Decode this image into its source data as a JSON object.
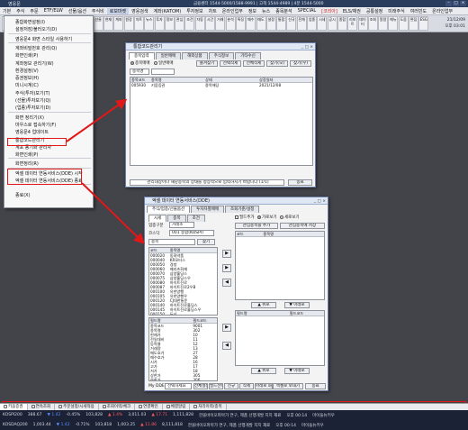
{
  "app": {
    "title": "영웅문",
    "server_info": "금융센터 1544-5000/1588-9991 | 고객 1544-4989 | 4분 1544-5000"
  },
  "menu": [
    "기본",
    "주식",
    "주문",
    "ETF/ELW",
    "선물/옵션",
    "주식비",
    "로보마켓",
    "영웅검색",
    "계좌(KATOM)",
    "투자정보",
    "차트",
    "온라인업무",
    "정보",
    "뉴스",
    "종목분석",
    "SPECIAL",
    "[코리아]",
    "ELS/채권",
    "공통설정",
    "미래주식",
    "여러빈도",
    "온라인업무"
  ],
  "toolbar": {
    "items": [
      "체결",
      "신고",
      "영웅",
      "알림",
      "종목",
      "주문",
      "매매",
      "잔고",
      "주식",
      "선물",
      "현재",
      "계좌",
      "원장",
      "차트",
      "뉴스",
      "투자",
      "정보",
      "관심",
      "조건",
      "자동",
      "시간",
      "거래",
      "분석",
      "특징",
      "매수",
      "매도",
      "설정",
      "통합",
      "신규",
      "전체",
      "업종",
      "시세",
      "공시",
      "종합",
      "리포트",
      "데이터",
      "조회",
      "알람",
      "메뉴",
      "도움",
      "편집",
      "ESG"
    ],
    "clock_date": "21/12/09",
    "clock_time": "오후 03:01"
  },
  "dropdown": {
    "items": [
      "종합화면설정(I)",
      "설정저장/불러오기(D)",
      "영웅문4 화면 스타일 사용하기",
      "계좌비밀번호 관리(Q)",
      "화면인쇄(P)",
      "계좌정보 관리기(W)",
      "환경설정(V)",
      "증권정보(H)",
      "미니시계(C)",
      "주식(투자)보기(T)",
      "(선물)투자보기(Q)",
      "(업종)투자보기(D)",
      "화면 정리기(X)",
      "마우스로 접속하기(F)",
      "영웅문4 업데이트",
      "통합코드관리기",
      "계포 동기화 관리자",
      "화면인쇄(P)",
      "화면정리(R)",
      "엑셀 데이터 연동서비스(DDE) 시작",
      "엑셀 데이터 연동서비스(DDE) 종료",
      "종료(X)"
    ]
  },
  "code_mgr": {
    "title": "통합코드관리기",
    "tabs": [
      "종목입력",
      "일반매매",
      "해외상품",
      "주식정보",
      "기타수신"
    ],
    "radio_a": "종목매매",
    "radio_b": "일반매매",
    "buttons": [
      "즐겨찾기",
      "선택삭제",
      "전체삭제",
      "찾기(모)",
      "찾기(우)"
    ],
    "filter": "종목명",
    "cols": [
      "종목코드",
      "종목명",
      "상태",
      "상장일자"
    ],
    "rows": [
      [
        "005930",
        "키움증권",
        "종목해당",
        "2021/12/08"
      ]
    ],
    "hint": "관리대상이나 해당종목의 상태를 정상적으로 입력하시기 바랍니다 (1/1)",
    "close": "종료"
  },
  "dde": {
    "title": "엑셀 데이터 연동서비스(DDE)",
    "main_tabs": [
      "주식/업종/선물옵션",
      "투자자별매매",
      "조회기준/설정"
    ],
    "sub_tabs": [
      "시세",
      "종목",
      "조건"
    ],
    "market": "거래소",
    "market2": "코스닥",
    "kospi_label": "업종구분",
    "kospi_val": "001 종합(KOSPI)",
    "code_input": "종목",
    "btn_search": "찾기",
    "list_cols": [
      "코드",
      "종목명"
    ],
    "codes": [
      [
        "000020",
        "동화약품"
      ],
      [
        "000040",
        "KR모터스"
      ],
      [
        "000050",
        "경방"
      ],
      [
        "000060",
        "메리츠화재"
      ],
      [
        "000070",
        "삼양홀딩스"
      ],
      [
        "000075",
        "삼양홀딩스우"
      ],
      [
        "000080",
        "하이트진로"
      ],
      [
        "000087",
        "하이트진로2우B"
      ],
      [
        "000100",
        "유한양행"
      ],
      [
        "000105",
        "유한양행우"
      ],
      [
        "000120",
        "CJ대한통운"
      ],
      [
        "000140",
        "하이트진로홀딩스"
      ],
      [
        "000145",
        "하이트진로홀딩스우"
      ],
      [
        "000150",
        "두산"
      ]
    ],
    "field_cols": [
      "필드명",
      "필드코드"
    ],
    "fields": [
      [
        "종목코드",
        "9001"
      ],
      [
        "종목명",
        "302"
      ],
      [
        "현재가",
        "10"
      ],
      [
        "전일대비",
        "11"
      ],
      [
        "등락율",
        "12"
      ],
      [
        "거래량",
        "13"
      ],
      [
        "매도호가",
        "27"
      ],
      [
        "매수호가",
        "28"
      ],
      [
        "시가",
        "16"
      ],
      [
        "고가",
        "17"
      ],
      [
        "저가",
        "18"
      ],
      [
        "상한가",
        "305"
      ],
      [
        "하한가",
        "306"
      ],
      [
        "전일종가",
        "307"
      ]
    ],
    "right_opts": [
      "필드추가",
      "가로보기",
      "세로보기"
    ],
    "right_btns": [
      "관심종목을 추가",
      "관심종목에 저장"
    ],
    "right_cols": [
      "코드",
      "종목명"
    ],
    "right_cols2": [
      "필드명",
      "필드코드"
    ],
    "up": "▲ 위로",
    "down": "▼ 아래로",
    "bottom": [
      "전체설정",
      "필드선택",
      "신규",
      "삭제",
      "아래로 화면 출력"
    ],
    "my_dde": "My DDE",
    "my_dde_val": "선택하세요",
    "send": "엑셀로 보내기",
    "close": "종료"
  },
  "status": {
    "tabs": [
      "키움증권",
      "연속조회",
      "주문설정/시세적용",
      "조회이력/체크",
      "연결확인",
      "체결알림",
      "처리이력/종목"
    ],
    "ticker1": [
      [
        "KOSPI200",
        "388.67",
        "▼ 1.42",
        "-0.45%",
        "103,828",
        "▲ 1.4%",
        "3,011.03",
        "▲ 17.71",
        "1,111,828",
        "한올바이오파마가 연구, 제품 선행개발 지지 재료",
        "오후 00:14",
        "마이들뉴키우"
      ]
    ],
    "ticker2": [
      [
        "KOSDAQ200",
        "1,003.44",
        "▼ 1.42",
        "-0.71%",
        "103,818",
        "1,003.25",
        "▲ 11.86",
        "8,111,818",
        "한올바이오파마가 연구, 제품 선행개발 지지 재료",
        "오후 00:14",
        "마이들뉴키우"
      ]
    ]
  }
}
